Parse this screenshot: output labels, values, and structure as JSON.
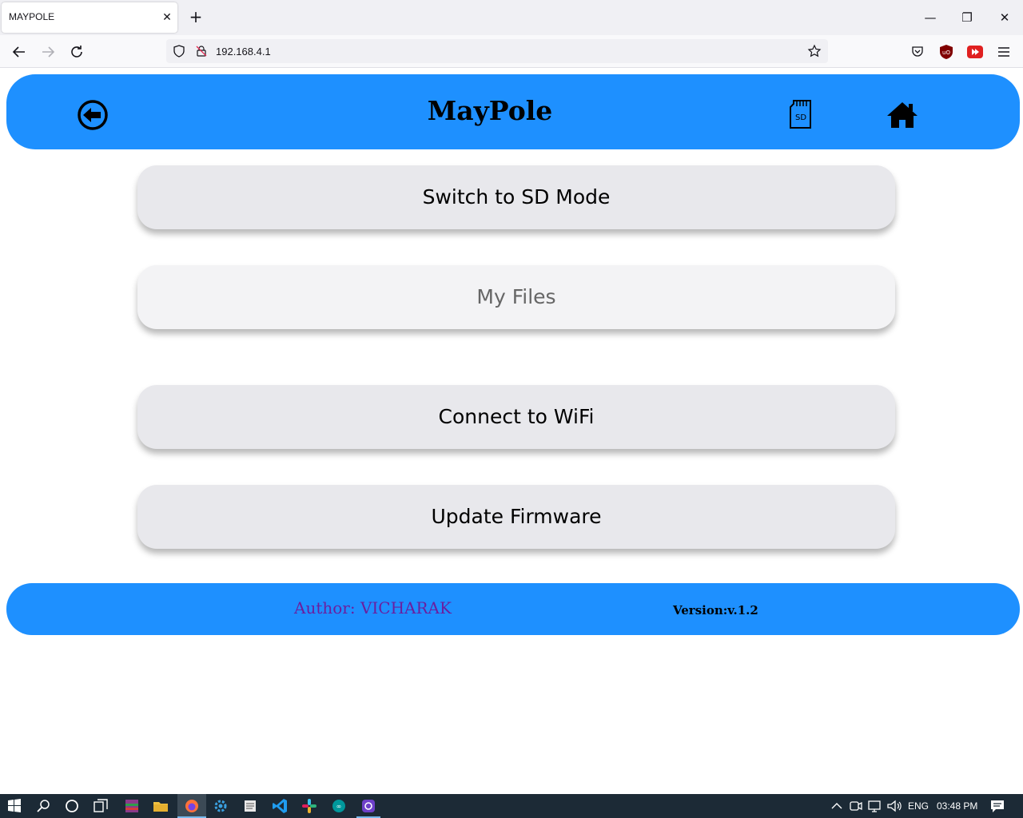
{
  "browser": {
    "tab_title": "MAYPOLE",
    "tab_close": "✕",
    "new_tab": "+",
    "url": "192.168.4.1",
    "window_controls": {
      "minimize": "—",
      "restore": "❐",
      "close": "✕"
    }
  },
  "header": {
    "title": "MayPole",
    "back_icon": "back-arrow-circle-icon",
    "sd_icon": "sd-card-icon",
    "sd_label": "SD",
    "home_icon": "home-icon",
    "color": "#1e90ff"
  },
  "menu": {
    "items": [
      {
        "label": "Switch to SD Mode"
      },
      {
        "label": "My Files"
      },
      {
        "label": "Connect to WiFi"
      },
      {
        "label": "Update Firmware"
      }
    ]
  },
  "footer": {
    "author": "Author: VICHARAK",
    "version": "Version:v.1.2"
  },
  "taskbar": {
    "language": "ENG",
    "time": "03:48 PM"
  }
}
